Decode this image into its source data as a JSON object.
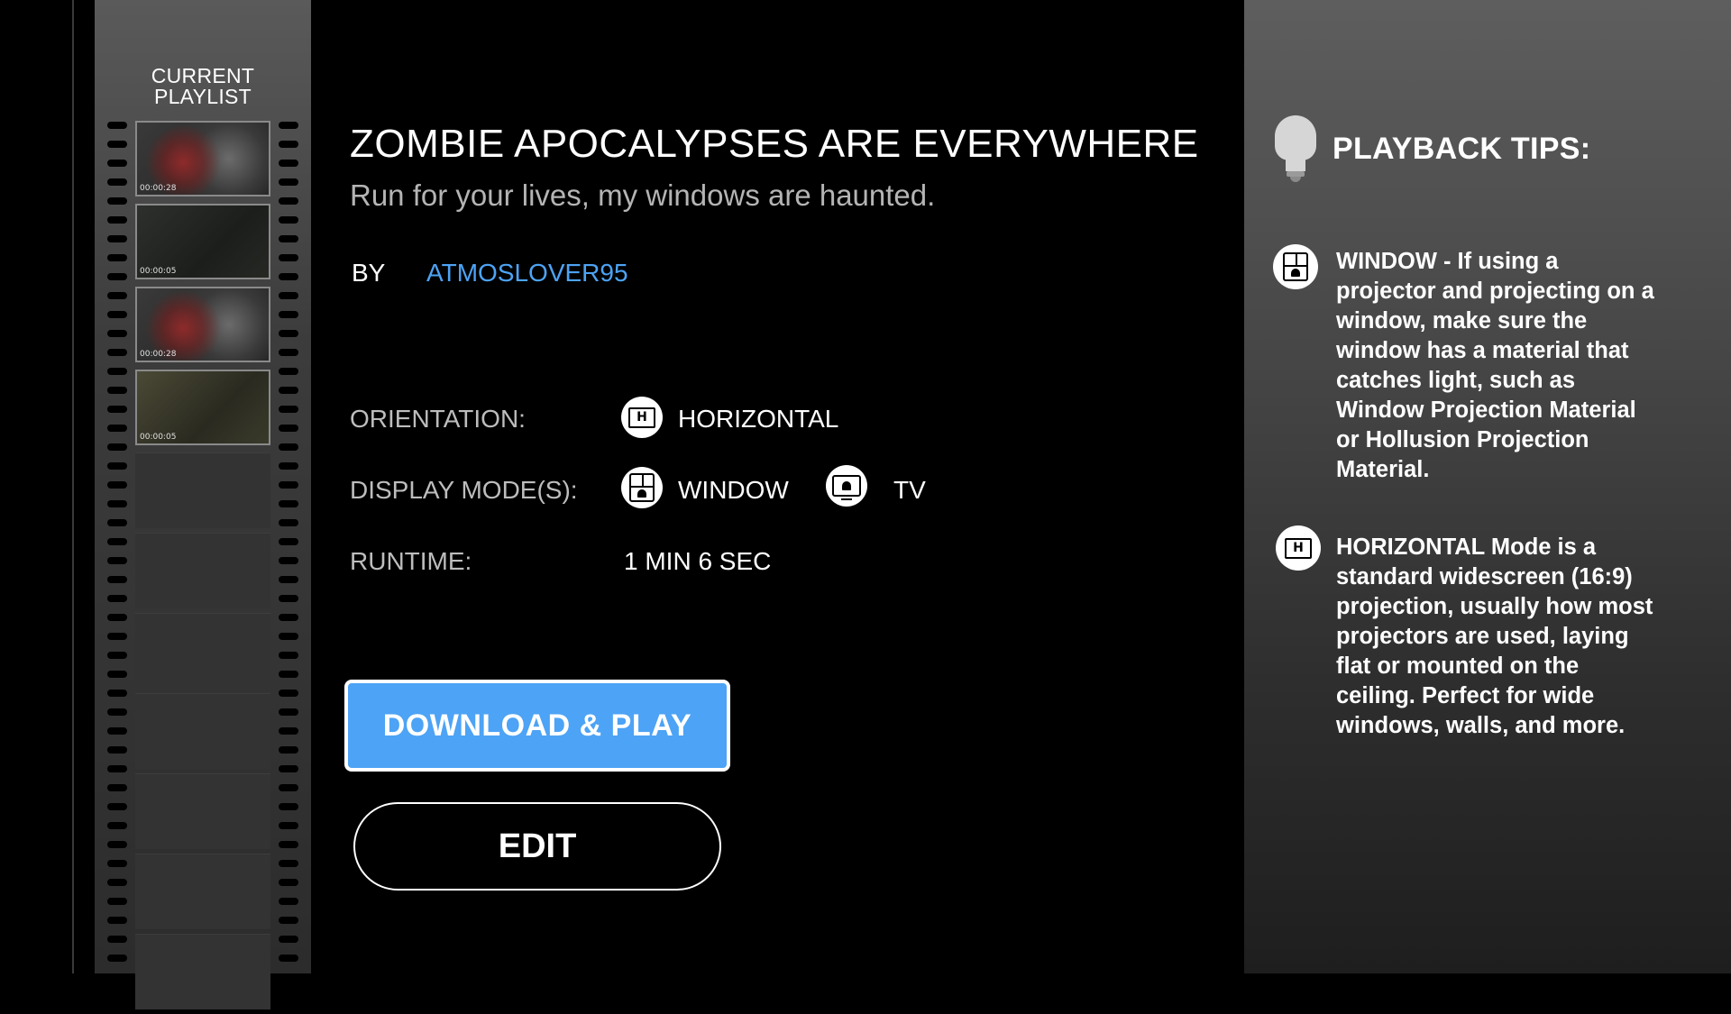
{
  "playlist": {
    "title_line1": "CURRENT",
    "title_line2": "PLAYLIST",
    "clips": [
      {
        "time": "00:00:28",
        "tone": "red"
      },
      {
        "time": "00:00:05",
        "tone": "dark"
      },
      {
        "time": "00:00:28",
        "tone": "red"
      },
      {
        "time": "00:00:05",
        "tone": "green"
      }
    ],
    "empty_slots": 7
  },
  "video": {
    "title": "ZOMBIE APOCALYPSES ARE EVERYWHERE",
    "subtitle": "Run for your lives, my windows are haunted.",
    "by_label": "BY",
    "author": "ATMOSLOVER95"
  },
  "info": {
    "orientation_label": "ORIENTATION:",
    "orientation_icon": "H",
    "orientation_value": "HORIZONTAL",
    "display_label": "DISPLAY MODE(S):",
    "display_modes": [
      {
        "icon": "window-icon",
        "label": "WINDOW"
      },
      {
        "icon": "tv-icon",
        "label": "TV"
      }
    ],
    "runtime_label": "RUNTIME:",
    "runtime_value": "1 MIN 6 SEC"
  },
  "buttons": {
    "download_label": "DOWNLOAD & PLAY",
    "edit_label": "EDIT",
    "download_color": "#4da3f5"
  },
  "tips": {
    "title": "PLAYBACK TIPS:",
    "window_tip": "WINDOW - If using a projector and projecting on a window, make sure the window has a material that catches light, such as Window Projection Material or Hollusion Projection Material.",
    "horizontal_icon": "H",
    "horizontal_tip": "HORIZONTAL Mode is a standard widescreen (16:9) projection, usually how most projectors are used, laying flat or mounted on the ceiling.  Perfect for wide windows, walls, and more."
  },
  "colors": {
    "accent": "#4da3f5",
    "background": "#000000"
  }
}
